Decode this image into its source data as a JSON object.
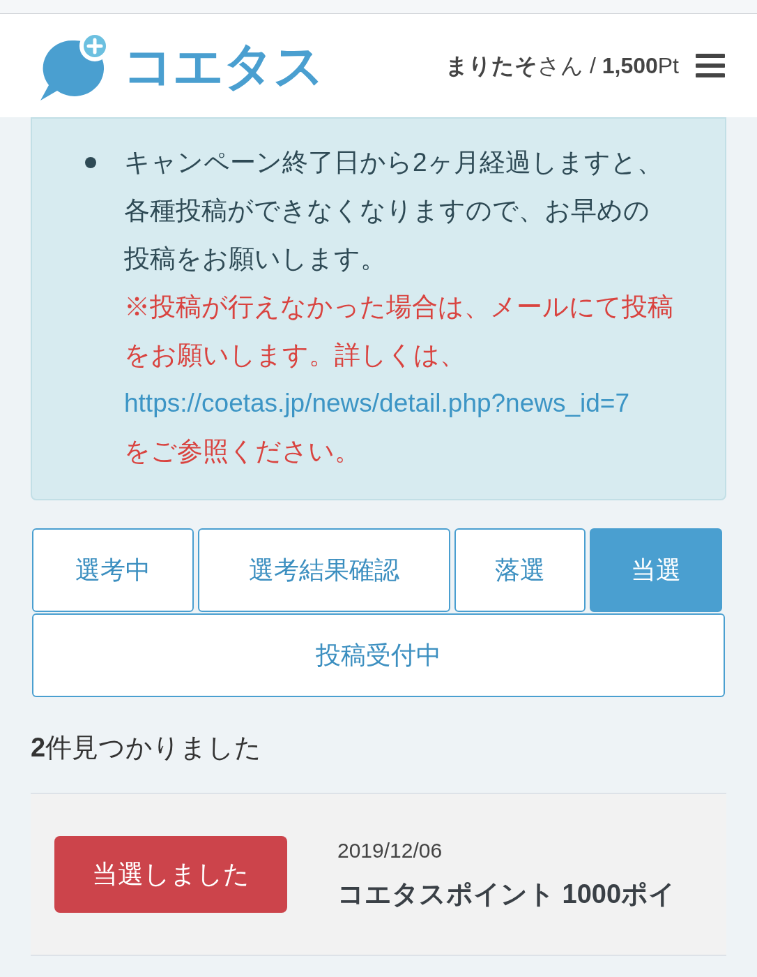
{
  "header": {
    "logo_text": "コエタス",
    "user": "**まりたそ**さん / **1,500**Pt"
  },
  "notice": {
    "items": [
      {
        "text": "キャンペーン終了日から2ヶ月経過しますと、各種投稿ができなくなりますので、お早めの投稿をお願いします。",
        "note": {
          "before": "※投稿が行えなかった場合は、メールにて投稿をお願いします。詳しくは、",
          "link": "https://coetas.jp/news/detail.php?news_id=7",
          "after": " をご参照ください。"
        }
      }
    ]
  },
  "tabs": [
    {
      "label": "選考中",
      "selected": false
    },
    {
      "label": "選考結果確認",
      "selected": false
    },
    {
      "label": "落選",
      "selected": false
    },
    {
      "label": "当選",
      "selected": true
    },
    {
      "label": "投稿受付中",
      "selected": false
    }
  ],
  "result_count": "**2**件見つかりました",
  "results": [
    {
      "status": "当選しました",
      "date": "2019/12/06",
      "title": "コエタスポイント 1000ポイ"
    }
  ]
}
